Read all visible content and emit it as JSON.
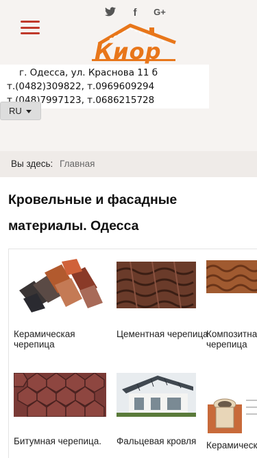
{
  "header": {
    "social": [
      {
        "icon": "twitter-icon",
        "glyph": "🐦"
      },
      {
        "icon": "facebook-icon",
        "glyph": "f"
      },
      {
        "icon": "google-plus-icon",
        "glyph": "G+"
      }
    ],
    "logo_text": "Киор",
    "address": "г. Одесса, ул. Краснова 11 б",
    "phone_line_1": "т.(0482)309822, т.0969609294",
    "phone_line_2": "т.(048)7997123, т.0686215728",
    "lang": "RU"
  },
  "breadcrumb": {
    "prefix": "Вы здесь:",
    "current": "Главная"
  },
  "main": {
    "title": "Кровельные и фасадные материалы. Одесса",
    "products": [
      {
        "label": "Керамическая черепица"
      },
      {
        "label": " Цементная черепица"
      },
      {
        "label": " Композитная черепица"
      },
      {
        "label": "Битумная черепица."
      },
      {
        "label": "Фальцевая кровля"
      },
      {
        "label": "Керамические"
      }
    ]
  },
  "colors": {
    "accent": "#c0392b",
    "logo": "#e8761a"
  }
}
